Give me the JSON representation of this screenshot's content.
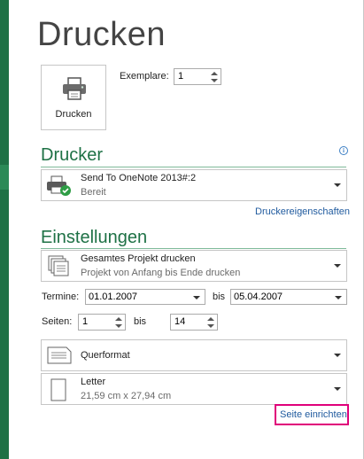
{
  "header": {
    "title": "Drucken"
  },
  "print": {
    "button_label": "Drucken",
    "icon": "printer-icon"
  },
  "copies": {
    "label": "Exemplare:",
    "value": "1"
  },
  "printer": {
    "heading": "Drucker",
    "selected_name": "Send To OneNote 2013#:2",
    "status": "Bereit",
    "properties_link": "Druckereigenschaften"
  },
  "settings": {
    "heading": "Einstellungen",
    "scope": {
      "title": "Gesamtes Projekt drucken",
      "subtitle": "Projekt von Anfang bis Ende drucken"
    },
    "dates": {
      "label": "Termine:",
      "from": "01.01.2007",
      "to_label": "bis",
      "to": "05.04.2007"
    },
    "pages": {
      "label": "Seiten:",
      "from": "1",
      "to_label": "bis",
      "to": "14"
    },
    "orientation": {
      "title": "Querformat"
    },
    "paper": {
      "title": "Letter",
      "size": "21,59 cm x 27,94 cm"
    },
    "page_setup_link": "Seite einrichten"
  },
  "colors": {
    "accent": "#1e7145",
    "link": "#1f5a9e",
    "highlight": "#e0007a"
  }
}
